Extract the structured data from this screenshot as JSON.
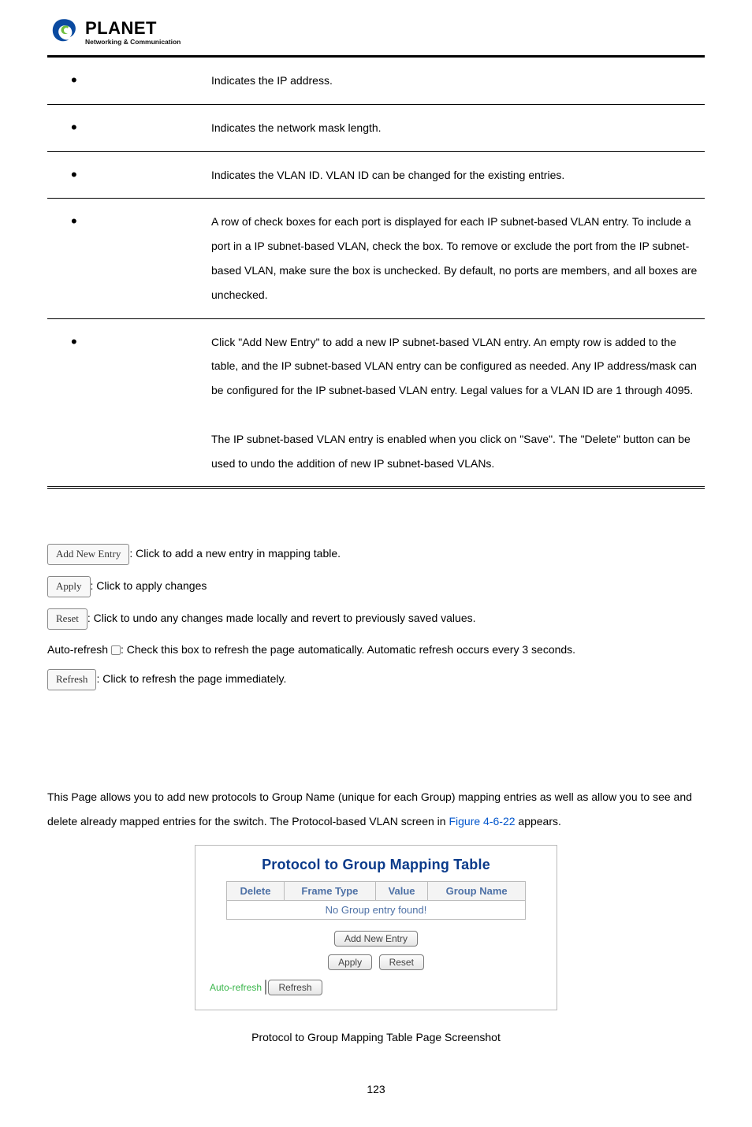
{
  "logo": {
    "word": "PLANET",
    "sub": "Networking & Communication"
  },
  "rows": [
    {
      "desc": "Indicates the IP address."
    },
    {
      "desc": "Indicates the network mask length."
    },
    {
      "desc": "Indicates the VLAN ID. VLAN ID can be changed for the existing entries."
    },
    {
      "desc": "A row of check boxes for each port is displayed for each IP subnet-based VLAN entry. To include a port in a IP subnet-based VLAN, check the box. To remove or exclude the port from the IP subnet-based VLAN, make sure the box is unchecked. By default, no ports are members, and all boxes are unchecked."
    },
    {
      "desc": "Click \"Add New Entry\" to add a new IP subnet-based VLAN entry. An empty row is added to the table, and the IP subnet-based VLAN entry can be configured as needed. Any IP address/mask can be configured for the IP subnet-based VLAN entry. Legal values for a VLAN ID are 1 through 4095.",
      "desc2": "The IP subnet-based VLAN entry is enabled when you click on \"Save\". The \"Delete\" button can be used to undo the addition of new IP subnet-based VLANs."
    }
  ],
  "buttons": {
    "addNewEntry": {
      "label": "Add New Entry",
      "text": ": Click to add a new entry in mapping table."
    },
    "apply": {
      "label": "Apply",
      "text": ": Click to apply changes"
    },
    "reset": {
      "label": "Reset",
      "text": ": Click to undo any changes made locally and revert to previously saved values."
    },
    "autoRefresh": {
      "prefix": "Auto-refresh ",
      "text": ": Check this box to refresh the page automatically. Automatic refresh occurs every 3 seconds."
    },
    "refresh": {
      "label": "Refresh",
      "text": ": Click to refresh the page immediately."
    }
  },
  "section": {
    "text1": "This Page allows you to add new protocols to Group Name (unique for each Group) mapping entries as well as allow you to see and delete already mapped entries for the switch. The Protocol-based VLAN screen in ",
    "figref": "Figure 4-6-22",
    "text2": " appears."
  },
  "screenshot": {
    "title": "Protocol to Group Mapping Table",
    "headers": {
      "c1": "Delete",
      "c2": "Frame Type",
      "c3": "Value",
      "c4": "Group Name"
    },
    "emptyMsg": "No Group entry found!",
    "addBtn": "Add New Entry",
    "applyBtn": "Apply",
    "resetBtn": "Reset",
    "autoLabel": "Auto-refresh",
    "refreshBtn": "Refresh"
  },
  "caption": "Protocol to Group Mapping Table Page Screenshot",
  "pageNum": "123"
}
